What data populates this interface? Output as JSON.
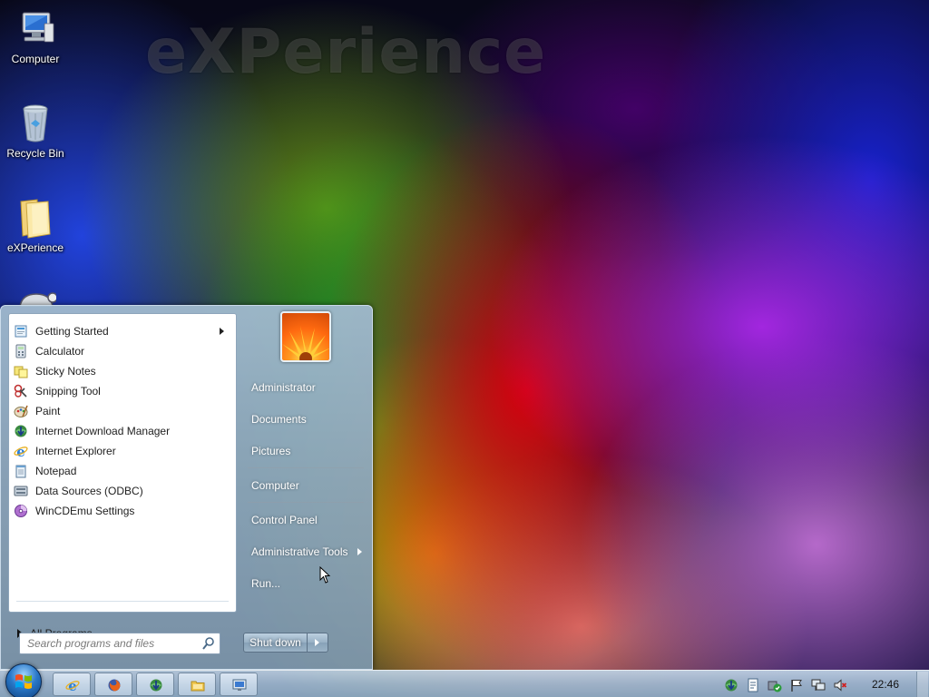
{
  "wallpaper": {
    "text": "eXPerience"
  },
  "desktop": {
    "icons": [
      {
        "label": "Computer",
        "icon": "computer-icon"
      },
      {
        "label": "Recycle Bin",
        "icon": "recycle-bin-icon"
      },
      {
        "label": "eXPerience",
        "icon": "folder-icon"
      }
    ]
  },
  "start_menu": {
    "programs": [
      {
        "label": "Getting Started",
        "icon": "getting-started-icon",
        "submenu": true
      },
      {
        "label": "Calculator",
        "icon": "calculator-icon"
      },
      {
        "label": "Sticky Notes",
        "icon": "sticky-notes-icon"
      },
      {
        "label": "Snipping Tool",
        "icon": "snipping-tool-icon"
      },
      {
        "label": "Paint",
        "icon": "paint-icon"
      },
      {
        "label": "Internet Download Manager",
        "icon": "idm-icon"
      },
      {
        "label": "Internet Explorer",
        "icon": "internet-explorer-icon"
      },
      {
        "label": "Notepad",
        "icon": "notepad-icon"
      },
      {
        "label": "Data Sources (ODBC)",
        "icon": "odbc-icon"
      },
      {
        "label": "WinCDEmu Settings",
        "icon": "wincdemu-icon"
      }
    ],
    "all_programs": "All Programs",
    "search_placeholder": "Search programs and files",
    "right_items": [
      {
        "label": "Administrator"
      },
      {
        "label": "Documents"
      },
      {
        "label": "Pictures"
      },
      {
        "label": "Computer"
      },
      {
        "label": "Control Panel"
      },
      {
        "label": "Administrative Tools",
        "submenu": true
      },
      {
        "label": "Run..."
      }
    ],
    "shutdown_label": "Shut down"
  },
  "taskbar": {
    "pinned": [
      {
        "icon": "internet-explorer-icon"
      },
      {
        "icon": "firefox-icon"
      },
      {
        "icon": "idm-icon"
      },
      {
        "icon": "explorer-folder-icon"
      },
      {
        "icon": "remote-desktop-icon"
      }
    ],
    "tray": [
      {
        "icon": "idm-tray-icon"
      },
      {
        "icon": "document-tray-icon"
      },
      {
        "icon": "security-tray-icon"
      },
      {
        "icon": "action-center-flag-icon"
      },
      {
        "icon": "network-icon"
      },
      {
        "icon": "volume-muted-icon"
      }
    ],
    "clock": "22:46"
  },
  "colors": {
    "taskbar": "#a8c0d6",
    "start_menu_right": "#8ca5b9",
    "accent": "#2a78c8"
  }
}
